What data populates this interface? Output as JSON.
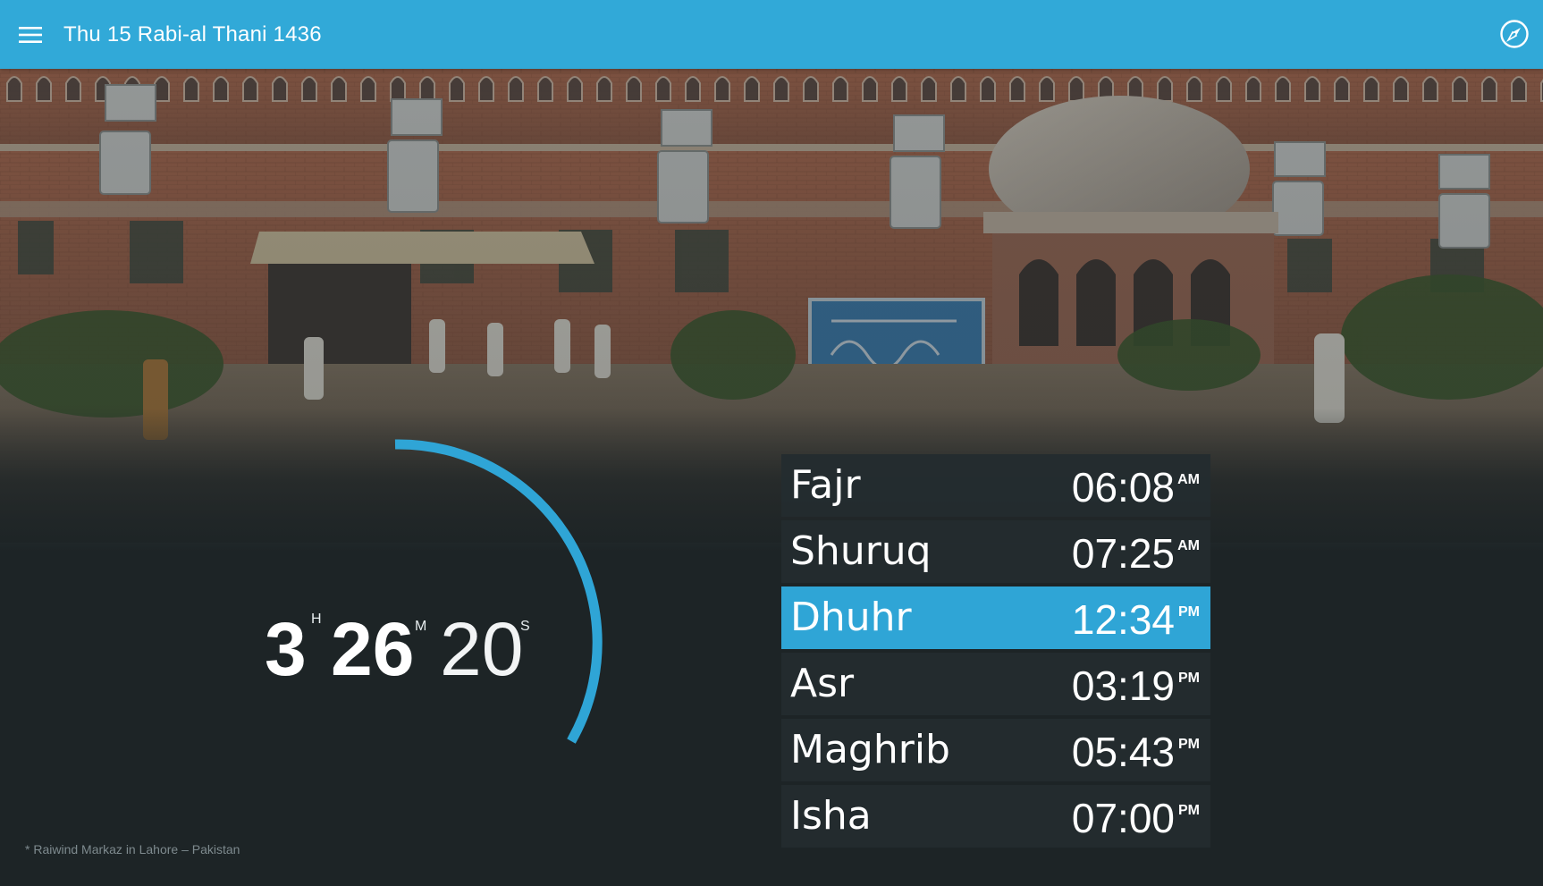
{
  "header": {
    "date": "Thu 15 Rabi-al Thani 1436",
    "menu_icon": "hamburger-menu-icon",
    "compass_icon": "compass-icon"
  },
  "countdown": {
    "hours": "3",
    "hours_unit": "H",
    "minutes": "26",
    "minutes_unit": "M",
    "seconds": "20",
    "seconds_unit": "S"
  },
  "prayers": [
    {
      "name": "Fajr",
      "time": "06:08",
      "ampm": "AM",
      "active": false
    },
    {
      "name": "Shuruq",
      "time": "07:25",
      "ampm": "AM",
      "active": false
    },
    {
      "name": "Dhuhr",
      "time": "12:34",
      "ampm": "PM",
      "active": true
    },
    {
      "name": "Asr",
      "time": "03:19",
      "ampm": "PM",
      "active": false
    },
    {
      "name": "Maghrib",
      "time": "05:43",
      "ampm": "PM",
      "active": false
    },
    {
      "name": "Isha",
      "time": "07:00",
      "ampm": "PM",
      "active": false
    }
  ],
  "photo_credit": "* Raiwind Markaz in Lahore – Pakistan",
  "colors": {
    "accent": "#31a9d8",
    "background": "#1d2426",
    "row": "#242c2f",
    "active_row": "#2fa5d6"
  }
}
